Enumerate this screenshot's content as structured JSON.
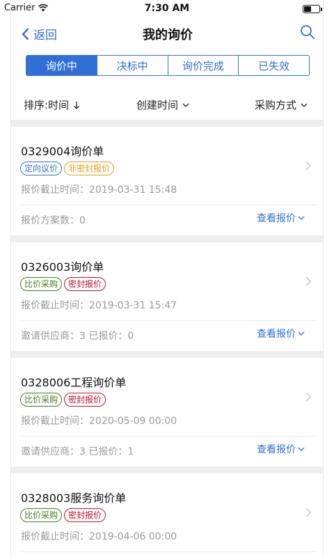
{
  "status": {
    "carrier": "Carrier",
    "time": "7:30 AM"
  },
  "nav": {
    "back": "返回",
    "title": "我的询价"
  },
  "tabs": [
    {
      "label": "询价中",
      "active": true
    },
    {
      "label": "决标中",
      "active": false
    },
    {
      "label": "询价完成",
      "active": false
    },
    {
      "label": "已失效",
      "active": false
    }
  ],
  "filters": {
    "sort": "排序:时间",
    "created": "创建时间",
    "method": "采购方式"
  },
  "colors": {
    "accent": "#2f6fd6",
    "tag_blue": "#2f6fd6",
    "tag_orange": "#e0a21a",
    "tag_green": "#3f7d1a",
    "tag_red": "#c0112b"
  },
  "cards": [
    {
      "title": "0329004询价单",
      "tags": [
        {
          "label": "定向议价",
          "color": "tag_blue"
        },
        {
          "label": "非密封报价",
          "color": "tag_orange"
        }
      ],
      "deadline": "报价截止时间：2019-03-31 15:48",
      "footer": "报价方案数：0",
      "action": "查看报价"
    },
    {
      "title": "0326003询价单",
      "tags": [
        {
          "label": "比价采购",
          "color": "tag_green"
        },
        {
          "label": "密封报价",
          "color": "tag_red"
        }
      ],
      "deadline": "报价截止时间：2019-03-31 15:47",
      "footer": "邀请供应商：3   已报价：0",
      "action": "查看报价"
    },
    {
      "title": "0328006工程询价单",
      "tags": [
        {
          "label": "比价采购",
          "color": "tag_green"
        },
        {
          "label": "密封报价",
          "color": "tag_red"
        }
      ],
      "deadline": "报价截止时间：2020-05-09 00:00",
      "footer": "邀请供应商：3   已报价：1",
      "action": "查看报价"
    },
    {
      "title": "0328003服务询价单",
      "tags": [
        {
          "label": "比价采购",
          "color": "tag_green"
        },
        {
          "label": "密封报价",
          "color": "tag_red"
        }
      ],
      "deadline": "报价截止时间：2019-04-06 00:00",
      "footer": "",
      "action": ""
    }
  ]
}
